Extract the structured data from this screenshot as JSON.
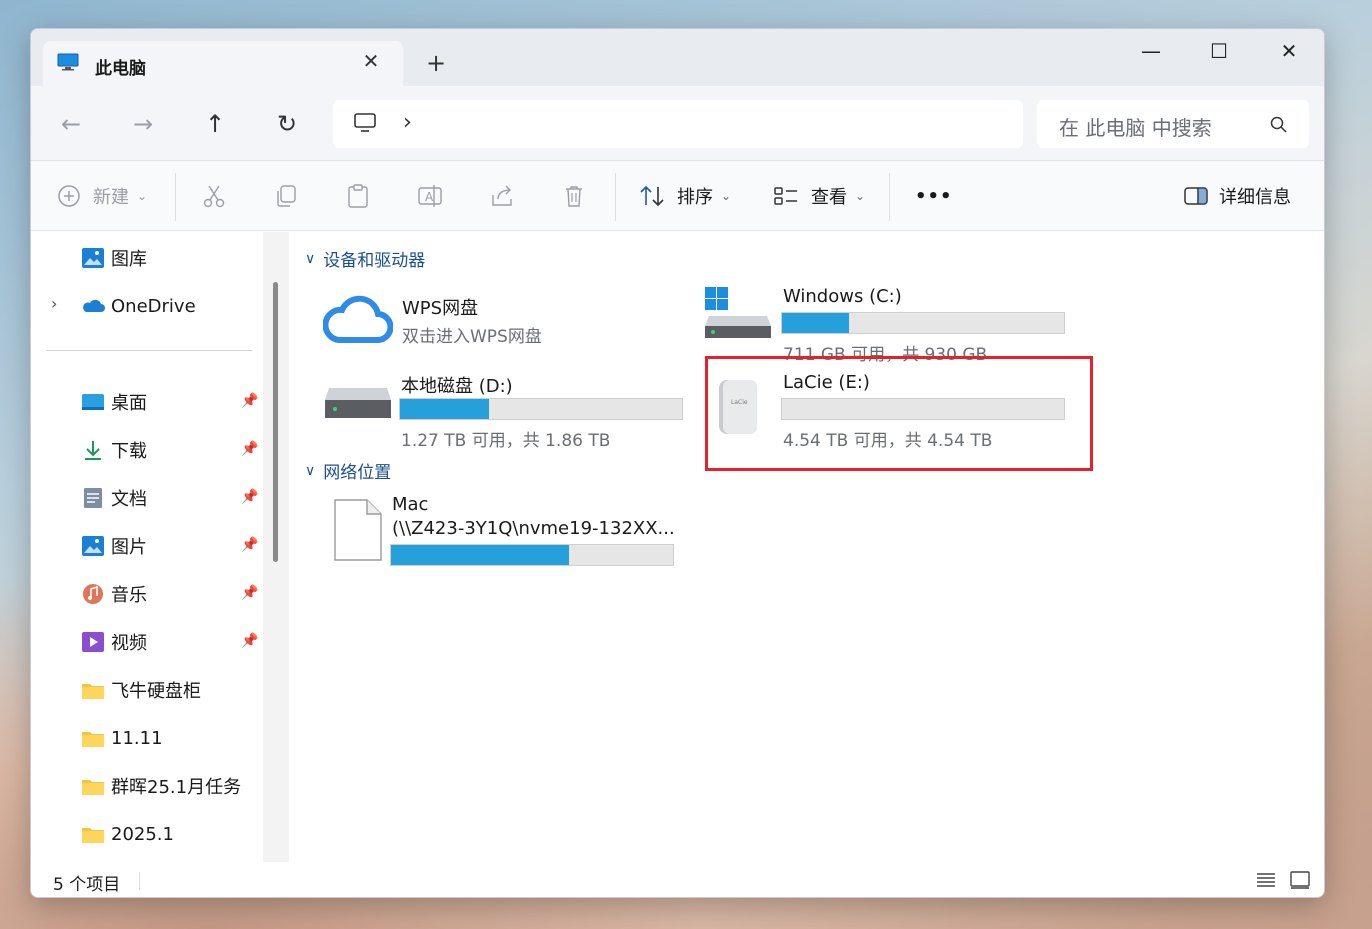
{
  "tab": {
    "title": "此电脑",
    "close": "✕",
    "new_tab": "+"
  },
  "window_controls": {
    "minimize": "—",
    "maximize": "☐",
    "close": "✕"
  },
  "nav": {
    "back": "←",
    "forward": "→",
    "up": "↑",
    "refresh": "↻",
    "crumb_chevron": "›"
  },
  "search": {
    "placeholder": "在 此电脑 中搜索"
  },
  "toolbar": {
    "new_label": "新建",
    "sort_label": "排序",
    "view_label": "查看",
    "more_label": "•••",
    "details_label": "详细信息"
  },
  "sidebar": {
    "top_items": [
      {
        "label": "图库",
        "icon": "gallery-icon"
      },
      {
        "label": "OneDrive",
        "icon": "onedrive-icon"
      }
    ],
    "pinned": [
      {
        "label": "桌面",
        "icon": "desktop-icon"
      },
      {
        "label": "下载",
        "icon": "download-icon"
      },
      {
        "label": "文档",
        "icon": "document-icon"
      },
      {
        "label": "图片",
        "icon": "pictures-icon"
      },
      {
        "label": "音乐",
        "icon": "music-icon"
      },
      {
        "label": "视频",
        "icon": "video-icon"
      }
    ],
    "folders": [
      {
        "label": "飞牛硬盘柜"
      },
      {
        "label": "11.11"
      },
      {
        "label": "群晖25.1月任务"
      },
      {
        "label": "2025.1"
      }
    ]
  },
  "main": {
    "devices_group": "设备和驱动器",
    "network_group": "网络位置",
    "drives": [
      {
        "name": "WPS网盘",
        "sub": "双击进入WPS网盘"
      },
      {
        "name": "Windows (C:)",
        "sub": "711 GB 可用，共 930 GB",
        "used_fraction": 0.236
      },
      {
        "name": "本地磁盘 (D:)",
        "sub": "1.27 TB 可用，共 1.86 TB",
        "used_fraction": 0.317
      },
      {
        "name": "LaCie (E:)",
        "sub": "4.54 TB 可用，共 4.54 TB",
        "used_fraction": 0.0
      }
    ],
    "network": [
      {
        "name": "Mac",
        "sub": "(\\\\Z423-3Y1Q\\nvme19-132XX...",
        "used_fraction": 0.63
      }
    ]
  },
  "status": {
    "item_count": "5 个项目"
  },
  "colors": {
    "accent_bar": "#26a0da",
    "highlight_box": "#e5212b",
    "group_header": "#1a4f8f"
  }
}
